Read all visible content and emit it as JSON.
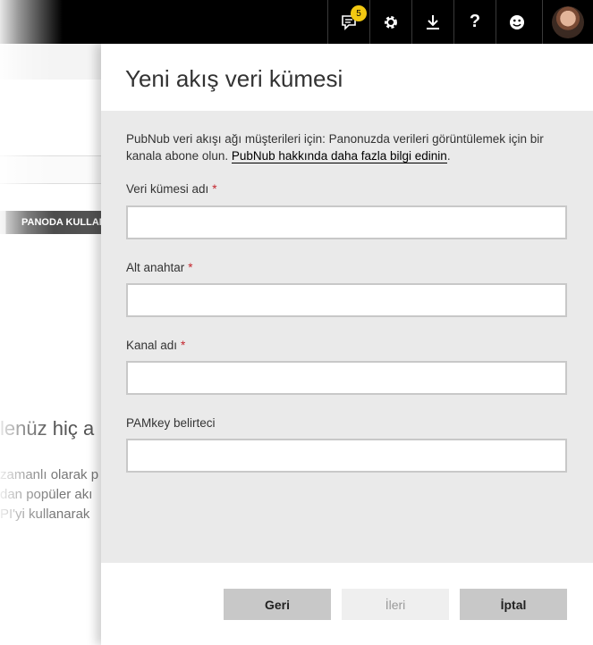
{
  "topbar": {
    "notifications": {
      "icon": "notification-icon",
      "count": "5"
    },
    "settings_icon": "gear-icon",
    "download_icon": "download-icon",
    "help_icon": "help-icon",
    "feedback_icon": "smiley-icon"
  },
  "background": {
    "tab_label": "PANODA KULLAN",
    "heading": "lenüz hiç a",
    "lines": [
      "zamanlı olarak p",
      "dan popüler akı",
      "PI'yi kullanarak"
    ]
  },
  "panel": {
    "title": "Yeni akış veri kümesi",
    "description": "PubNub veri akışı ağı müşterileri için: Panonuzda verileri görüntülemek için bir kanala abone olun.",
    "learn_more_link": "PubNub hakkında daha fazla bilgi edinin",
    "fields": [
      {
        "label": "Veri kümesi adı",
        "required": "*",
        "value": ""
      },
      {
        "label": "Alt anahtar",
        "required": "*",
        "value": ""
      },
      {
        "label": "Kanal adı",
        "required": "*",
        "value": ""
      },
      {
        "label": "PAMkey belirteci",
        "value": ""
      }
    ],
    "buttons": {
      "back": "Geri",
      "next": "İleri",
      "cancel": "İptal"
    }
  },
  "colors": {
    "accent_badge": "#f2c811",
    "required_star": "#c4262e",
    "topbar": "#000000"
  }
}
